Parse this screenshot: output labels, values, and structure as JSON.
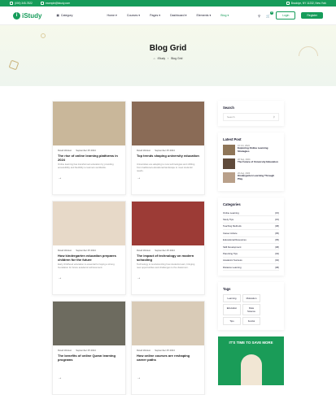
{
  "topbar": {
    "phone": "(000) 345-7822",
    "email": "example@istudy.com",
    "address": "Brooklyn, NY 11232, New York"
  },
  "nav": {
    "logo": "iStudy",
    "category": "Category",
    "menu": [
      "Home",
      "Courses",
      "Pages",
      "Dashboard",
      "Elements",
      "Blog"
    ],
    "cart_count": "0",
    "login": "Login",
    "register": "Register"
  },
  "hero": {
    "title": "Blog Grid",
    "crumb_home": "iStudy",
    "crumb_current": "Blog Grid"
  },
  "posts": [
    {
      "author": "David Welson",
      "date": "September 25 2024",
      "title": "The rise of online learning platforms in 2024",
      "excerpt": "Online learning has transformed education by providing accessibility and flexibility to learners worldwide.",
      "thumb": "#c9b79a"
    },
    {
      "author": "David Welson",
      "date": "September 25 2024",
      "title": "Top trends shaping university education",
      "excerpt": "Universities are adapting to new technologies and shifting from traditional educational landscape to meet students' needs.",
      "thumb": "#8a6b56"
    },
    {
      "author": "David Welson",
      "date": "September 25 2024",
      "title": "How kindergarten education prepares children for the future",
      "excerpt": "Early childhood education is essential for laying a strong foundation for future academic achievement.",
      "thumb": "#e7d9c8"
    },
    {
      "author": "David Welson",
      "date": "September 25 2024",
      "title": "The impact of technology on modern schooling",
      "excerpt": "Technology is revolutionizing how students learn, bringing new opportunities and challenges to the classroom.",
      "thumb": "#9c3b36"
    },
    {
      "author": "David Welson",
      "date": "September 25 2024",
      "title": "The benefits of online Quran learning programs",
      "excerpt": "",
      "thumb": "#6d6b5f"
    },
    {
      "author": "David Welson",
      "date": "September 25 2024",
      "title": "How online courses are reshaping career paths",
      "excerpt": "",
      "thumb": "#d9cbb7"
    }
  ],
  "sidebar": {
    "search_title": "Search",
    "search_placeholder": "Search",
    "latest_title": "Latest Post",
    "latest": [
      {
        "date": "10 Oct, 2024",
        "title": "Exploring Online Learning Strategies",
        "thumb": "#8f7658"
      },
      {
        "date": "20 Sep, 2024",
        "title": "The Future of University Education",
        "thumb": "#5f4a3a"
      },
      {
        "date": "20 Aug, 2024",
        "title": "Kindergarten Learning Through Play",
        "thumb": "#b9a08a"
      }
    ],
    "categories_title": "Categories",
    "categories": [
      {
        "name": "Online Learning",
        "count": "(15)"
      },
      {
        "name": "Study Tips",
        "count": "(15)"
      },
      {
        "name": "Teaching Methods",
        "count": "(08)"
      },
      {
        "name": "Career Advice",
        "count": "(05)"
      },
      {
        "name": "Educational Resources",
        "count": "(05)"
      },
      {
        "name": "Skill Development",
        "count": "(08)"
      },
      {
        "name": "Parenting Tips",
        "count": "(04)"
      },
      {
        "name": "Academic Success",
        "count": "(02)"
      },
      {
        "name": "Distance Learning",
        "count": "(08)"
      }
    ],
    "tags_title": "Tags",
    "tags": [
      "Learning",
      "Motivation",
      "Education",
      "Data Science",
      "Tips",
      "Kovilot"
    ],
    "promo_title": "IT'S TIME TO SAVE MORE"
  },
  "colors": {
    "brand": "#169c5a"
  }
}
